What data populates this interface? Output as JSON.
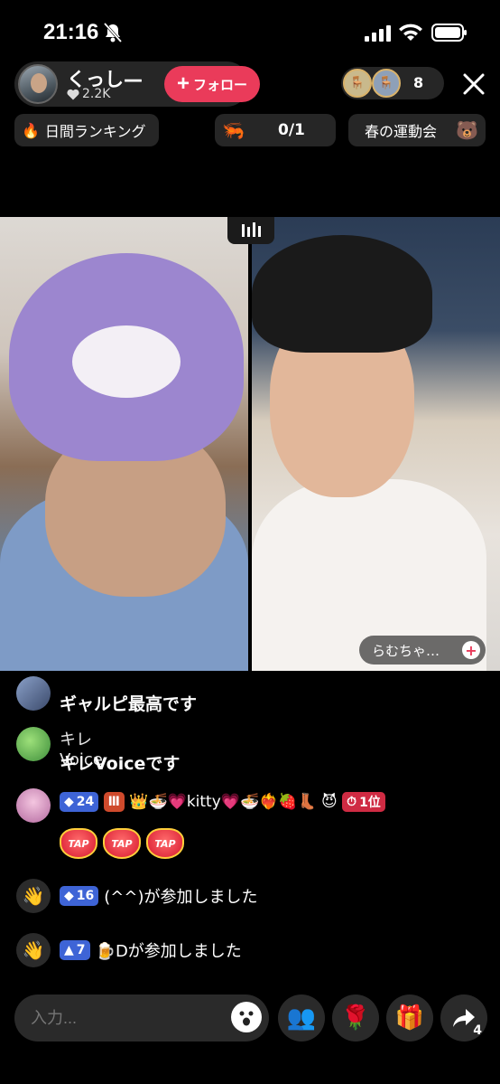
{
  "status": {
    "time": "21:16"
  },
  "host": {
    "name": "くっし—",
    "likes": "2.2K",
    "follow_label": "フォロー"
  },
  "viewers": {
    "count": "8"
  },
  "tags": {
    "ranking": "日間ランキング",
    "score": "0/1",
    "event": "春の運動会"
  },
  "guest": {
    "name": "らむちゃ…"
  },
  "chat": [
    {
      "type": "message",
      "user": "",
      "text": "ギャルピ最高です"
    },
    {
      "type": "message",
      "user": "キレVoice",
      "text": "キレVoiceです"
    },
    {
      "type": "gift",
      "level": "24",
      "badge": "Ⅲ",
      "text": "👑🍜💗kitty💗🍜❤️‍🔥🍓👢 😈",
      "rank": "1位",
      "tap_label": "TAP"
    },
    {
      "type": "join",
      "level": "16",
      "text": "(^^)が参加しました"
    },
    {
      "type": "join",
      "level": "7",
      "text": "🍺Dが参加しました"
    }
  ],
  "input": {
    "placeholder": "入力..."
  },
  "share": {
    "count": "4"
  },
  "colors": {
    "accent": "#ea3b5a",
    "level_blue": "#3e64d6"
  },
  "icons": [
    "bell-off-icon",
    "signal-icon",
    "wifi-icon",
    "battery-icon",
    "heart-icon",
    "close-icon",
    "fire-icon",
    "dragon-icon",
    "bear-icon",
    "split-screen-icon",
    "wave-icon",
    "emoji-icon",
    "multi-guest-icon",
    "rose-icon",
    "gift-icon",
    "share-icon"
  ]
}
